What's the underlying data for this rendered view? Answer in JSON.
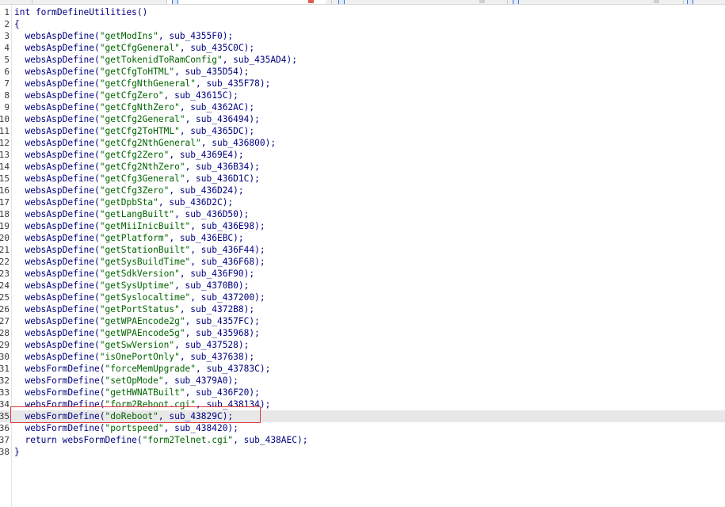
{
  "colors": {
    "code_text": "#000080",
    "string_literal": "#006400",
    "line_number": "#3a3a3a",
    "highlight_bg": "#e8e8e8",
    "annotation_box": "#d83b3b"
  },
  "icons": [
    "document-tab-icon",
    "tab-close-icon"
  ],
  "editor": {
    "highlighted_line": 35,
    "annotated_line": 35,
    "lines": [
      {
        "n": "1",
        "pre": "int formDefineUtilities()",
        "str": "",
        "post": ""
      },
      {
        "n": "2",
        "pre": "{",
        "str": "",
        "post": ""
      },
      {
        "n": "3",
        "pre": "  websAspDefine(",
        "str": "\"getModIns\"",
        "post": ", sub_4355F0);"
      },
      {
        "n": "4",
        "pre": "  websAspDefine(",
        "str": "\"getCfgGeneral\"",
        "post": ", sub_435C0C);"
      },
      {
        "n": "5",
        "pre": "  websAspDefine(",
        "str": "\"getTokenidToRamConfig\"",
        "post": ", sub_435AD4);"
      },
      {
        "n": "6",
        "pre": "  websAspDefine(",
        "str": "\"getCfgToHTML\"",
        "post": ", sub_435D54);"
      },
      {
        "n": "7",
        "pre": "  websAspDefine(",
        "str": "\"getCfgNthGeneral\"",
        "post": ", sub_435F78);"
      },
      {
        "n": "8",
        "pre": "  websAspDefine(",
        "str": "\"getCfgZero\"",
        "post": ", sub_43615C);"
      },
      {
        "n": "9",
        "pre": "  websAspDefine(",
        "str": "\"getCfgNthZero\"",
        "post": ", sub_4362AC);"
      },
      {
        "n": "10",
        "pre": "  websAspDefine(",
        "str": "\"getCfg2General\"",
        "post": ", sub_436494);"
      },
      {
        "n": "11",
        "pre": "  websAspDefine(",
        "str": "\"getCfg2ToHTML\"",
        "post": ", sub_4365DC);"
      },
      {
        "n": "12",
        "pre": "  websAspDefine(",
        "str": "\"getCfg2NthGeneral\"",
        "post": ", sub_436800);"
      },
      {
        "n": "13",
        "pre": "  websAspDefine(",
        "str": "\"getCfg2Zero\"",
        "post": ", sub_4369E4);"
      },
      {
        "n": "14",
        "pre": "  websAspDefine(",
        "str": "\"getCfg2NthZero\"",
        "post": ", sub_436B34);"
      },
      {
        "n": "15",
        "pre": "  websAspDefine(",
        "str": "\"getCfg3General\"",
        "post": ", sub_436D1C);"
      },
      {
        "n": "16",
        "pre": "  websAspDefine(",
        "str": "\"getCfg3Zero\"",
        "post": ", sub_436D24);"
      },
      {
        "n": "17",
        "pre": "  websAspDefine(",
        "str": "\"getDpbSta\"",
        "post": ", sub_436D2C);"
      },
      {
        "n": "18",
        "pre": "  websAspDefine(",
        "str": "\"getLangBuilt\"",
        "post": ", sub_436D50);"
      },
      {
        "n": "19",
        "pre": "  websAspDefine(",
        "str": "\"getMiiInicBuilt\"",
        "post": ", sub_436E98);"
      },
      {
        "n": "20",
        "pre": "  websAspDefine(",
        "str": "\"getPlatform\"",
        "post": ", sub_436EBC);"
      },
      {
        "n": "21",
        "pre": "  websAspDefine(",
        "str": "\"getStationBuilt\"",
        "post": ", sub_436F44);"
      },
      {
        "n": "22",
        "pre": "  websAspDefine(",
        "str": "\"getSysBuildTime\"",
        "post": ", sub_436F68);"
      },
      {
        "n": "23",
        "pre": "  websAspDefine(",
        "str": "\"getSdkVersion\"",
        "post": ", sub_436F90);"
      },
      {
        "n": "24",
        "pre": "  websAspDefine(",
        "str": "\"getSysUptime\"",
        "post": ", sub_4370B0);"
      },
      {
        "n": "25",
        "pre": "  websAspDefine(",
        "str": "\"getSyslocaltime\"",
        "post": ", sub_437200);"
      },
      {
        "n": "26",
        "pre": "  websAspDefine(",
        "str": "\"getPortStatus\"",
        "post": ", sub_4372B8);"
      },
      {
        "n": "27",
        "pre": "  websAspDefine(",
        "str": "\"getWPAEncode2g\"",
        "post": ", sub_4357FC);"
      },
      {
        "n": "28",
        "pre": "  websAspDefine(",
        "str": "\"getWPAEncode5g\"",
        "post": ", sub_435968);"
      },
      {
        "n": "29",
        "pre": "  websAspDefine(",
        "str": "\"getSwVersion\"",
        "post": ", sub_437528);"
      },
      {
        "n": "30",
        "pre": "  websAspDefine(",
        "str": "\"isOnePortOnly\"",
        "post": ", sub_437638);"
      },
      {
        "n": "31",
        "pre": "  websFormDefine(",
        "str": "\"forceMemUpgrade\"",
        "post": ", sub_43783C);"
      },
      {
        "n": "32",
        "pre": "  websFormDefine(",
        "str": "\"setOpMode\"",
        "post": ", sub_4379A0);"
      },
      {
        "n": "33",
        "pre": "  websFormDefine(",
        "str": "\"getHWNATBuilt\"",
        "post": ", sub_436F20);"
      },
      {
        "n": "34",
        "pre": "  websFormDefine(",
        "str": "\"form2Reboot.cgi\"",
        "post": ", sub_438134);"
      },
      {
        "n": "35",
        "pre": "  websFormDefine(",
        "str": "\"doReboot\"",
        "post": ", sub_43829C);"
      },
      {
        "n": "36",
        "pre": "  websFormDefine(",
        "str": "\"portspeed\"",
        "post": ", sub_438420);"
      },
      {
        "n": "37",
        "pre": "  return websFormDefine(",
        "str": "\"form2Telnet.cgi\"",
        "post": ", sub_438AEC);"
      },
      {
        "n": "38",
        "pre": "}",
        "str": "",
        "post": ""
      }
    ]
  }
}
